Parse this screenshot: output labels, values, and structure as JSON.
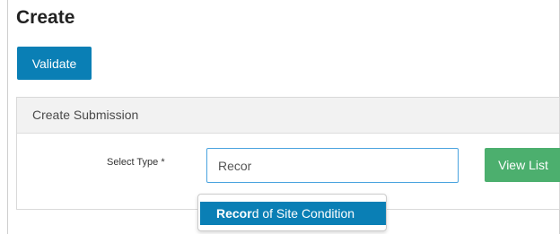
{
  "page": {
    "title": "Create",
    "validate_label": "Validate"
  },
  "panel": {
    "title": "Create Submission",
    "select_type_label": "Select Type *",
    "type_input_value": "Recor",
    "view_list_label": "View List"
  },
  "autocomplete": {
    "items": [
      {
        "match": "Recor",
        "rest": "d of Site Condition",
        "highlighted": true
      }
    ]
  },
  "colors": {
    "primary": "#0a7fb5",
    "success": "#4caf6e",
    "input_focus_border": "#4aa3df",
    "panel_header_bg": "#f2f2f2"
  }
}
